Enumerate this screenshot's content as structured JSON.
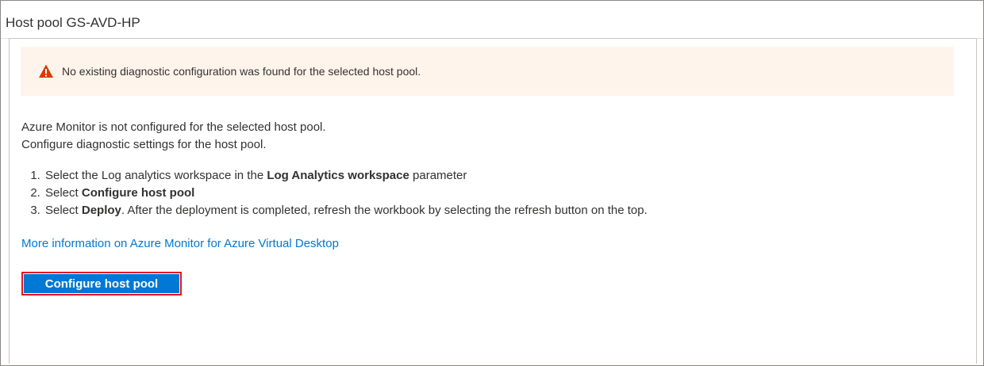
{
  "pane": {
    "title": "Host pool GS-AVD-HP"
  },
  "warning": {
    "icon": "warning-triangle-icon",
    "color": "#d83b01",
    "background": "#fff4ec",
    "message": "No existing diagnostic configuration was found for the selected host pool."
  },
  "description": {
    "line1": "Azure Monitor is not configured for the selected host pool.",
    "line2": "Configure diagnostic settings for the host pool."
  },
  "steps": [
    {
      "before": "Select the Log analytics workspace in the ",
      "bold": "Log Analytics workspace",
      "after": " parameter"
    },
    {
      "before": "Select ",
      "bold": "Configure host pool",
      "after": ""
    },
    {
      "before": "Select ",
      "bold": "Deploy",
      "after": ". After the deployment is completed, refresh the workbook by selecting the refresh button on the top."
    }
  ],
  "link": {
    "label": "More information on Azure Monitor for Azure Virtual Desktop",
    "color": "#0078d4"
  },
  "action": {
    "label": "Configure host pool",
    "color": "#0078d4",
    "highlight_color": "#e81123"
  }
}
